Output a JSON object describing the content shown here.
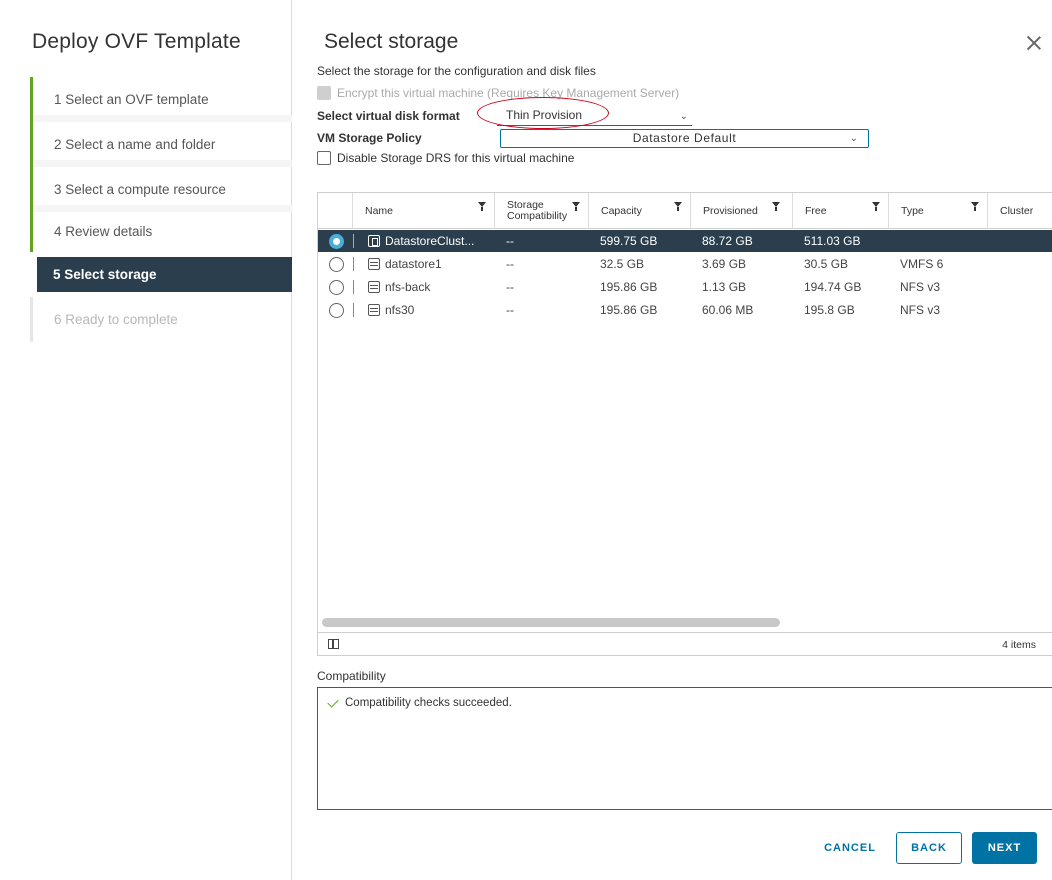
{
  "wizard": {
    "title": "Deploy OVF Template",
    "steps": [
      {
        "label": "1  Select an OVF template",
        "state": "done"
      },
      {
        "label": "2  Select a name and folder",
        "state": "done"
      },
      {
        "label": "3  Select a compute resource",
        "state": "done"
      },
      {
        "label": "4  Review details",
        "state": "done"
      },
      {
        "label": "5  Select storage",
        "state": "current"
      },
      {
        "label": "6  Ready to complete",
        "state": "future"
      }
    ]
  },
  "page": {
    "title": "Select storage",
    "description": "Select the storage for the configuration and disk files",
    "encrypt_label": "Encrypt this virtual machine (Requires Key Management Server)",
    "disk_format_label": "Select virtual disk format",
    "disk_format_value": "Thin Provision",
    "policy_label": "VM Storage Policy",
    "policy_value": "Datastore Default",
    "drs_label": "Disable Storage DRS for this virtual machine"
  },
  "table": {
    "columns": [
      "Name",
      "Storage\nCompatibility",
      "Capacity",
      "Provisioned",
      "Free",
      "Type",
      "Cluster"
    ],
    "col_name": "Name",
    "col_compat_1": "Storage",
    "col_compat_2": "Compatibility",
    "col_capacity": "Capacity",
    "col_provisioned": "Provisioned",
    "col_free": "Free",
    "col_type": "Type",
    "col_cluster": "Cluster",
    "rows": [
      {
        "name": "DatastoreClust...",
        "compat": "--",
        "capacity": "599.75 GB",
        "provisioned": "88.72 GB",
        "free": "511.03 GB",
        "type": "",
        "cluster": "",
        "selected": true
      },
      {
        "name": "datastore1",
        "compat": "--",
        "capacity": "32.5 GB",
        "provisioned": "3.69 GB",
        "free": "30.5 GB",
        "type": "VMFS 6",
        "cluster": "",
        "selected": false
      },
      {
        "name": "nfs-back",
        "compat": "--",
        "capacity": "195.86 GB",
        "provisioned": "1.13 GB",
        "free": "194.74 GB",
        "type": "NFS v3",
        "cluster": "",
        "selected": false
      },
      {
        "name": "nfs30",
        "compat": "--",
        "capacity": "195.86 GB",
        "provisioned": "60.06 MB",
        "free": "195.8 GB",
        "type": "NFS v3",
        "cluster": "",
        "selected": false
      }
    ],
    "item_count": "4 items"
  },
  "compatibility": {
    "label": "Compatibility",
    "message": "Compatibility checks succeeded."
  },
  "buttons": {
    "cancel": "CANCEL",
    "back": "BACK",
    "next": "NEXT"
  },
  "colors": {
    "accent": "#0072a3",
    "selected_row": "#2b3e4d",
    "progress": "#62a420",
    "highlight_ring": "#d0021b"
  }
}
